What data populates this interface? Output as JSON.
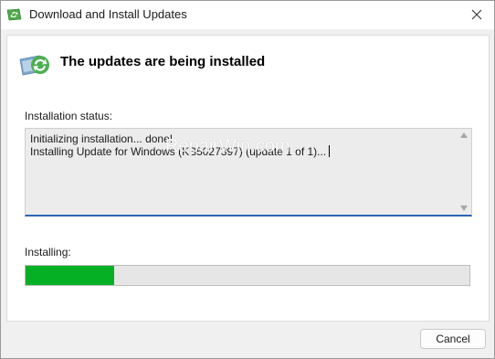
{
  "window": {
    "title": "Download and Install Updates"
  },
  "header": {
    "title": "The updates are being installed",
    "icon": "windows-update-icon"
  },
  "status": {
    "label": "Installation status:",
    "lines": [
      "Initializing installation... done!",
      "Installing Update for Windows (KB5027397) (update 1 of 1)..."
    ]
  },
  "watermark": "RepairWin.com",
  "progress": {
    "label": "Installing:",
    "fraction": 0.2,
    "color": "#06b025"
  },
  "buttons": {
    "cancel_label": "Cancel"
  },
  "colors": {
    "accent": "#2a66b5",
    "progress": "#06b025"
  }
}
